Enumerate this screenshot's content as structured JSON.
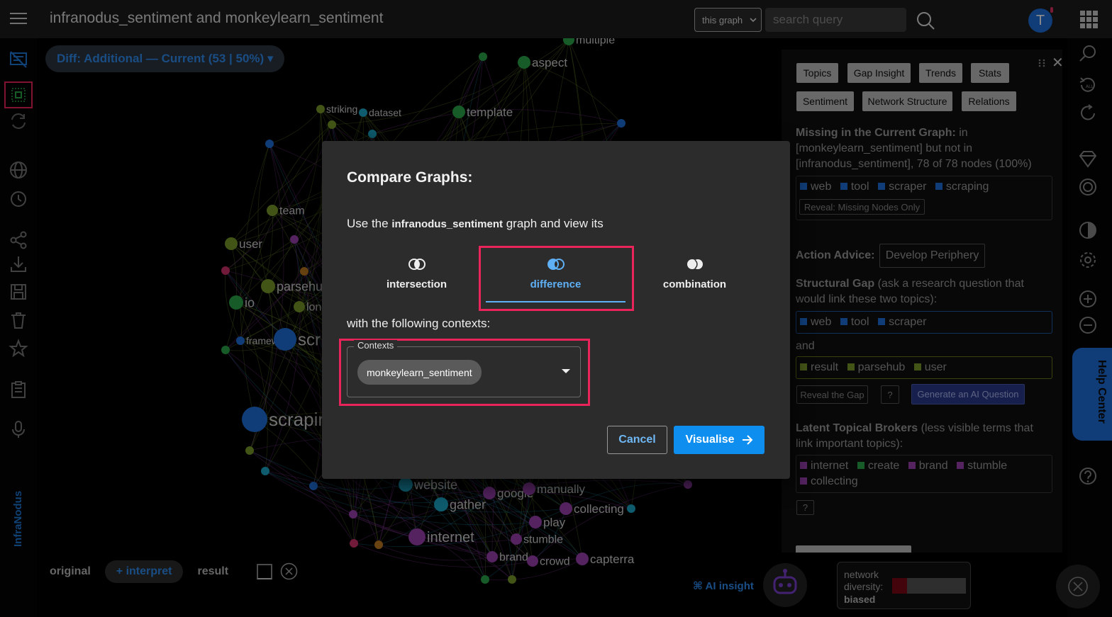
{
  "header": {
    "title": "infranodus_sentiment and monkeylearn_sentiment",
    "scope_select": "this graph",
    "search_placeholder": "search query",
    "avatar_letter": "T"
  },
  "sidebar": {
    "brand": "InfraNodus"
  },
  "canvas": {
    "diff_chip": "Diff: Additional — Current (53 | 50%) ▾",
    "nodes": [
      {
        "label": "multiple",
        "color": "#2aa84a",
        "size": 16
      },
      {
        "label": "aspect",
        "color": "#2aa84a",
        "size": 17
      },
      {
        "label": "striking",
        "color": "#7a9a2a",
        "size": 14
      },
      {
        "label": "dataset",
        "color": "#1aa8c8",
        "size": 14
      },
      {
        "label": "template",
        "color": "#2aa84a",
        "size": 17
      },
      {
        "label": "team",
        "color": "#7a9a2a",
        "size": 16
      },
      {
        "label": "user",
        "color": "#7a9a2a",
        "size": 17
      },
      {
        "label": "parsehu",
        "color": "#7a9a2a",
        "size": 18
      },
      {
        "label": "io",
        "color": "#2aa84a",
        "size": 18
      },
      {
        "label": "lon",
        "color": "#7a9a2a",
        "size": 16
      },
      {
        "label": "framework",
        "color": "#1e6fd9",
        "size": 14
      },
      {
        "label": "scr",
        "color": "#1e6fd9",
        "size": 24
      },
      {
        "label": "scrapir",
        "color": "#1e6fd9",
        "size": 26
      },
      {
        "label": "website",
        "color": "#1aa8c8",
        "size": 18
      },
      {
        "label": "google",
        "color": "#9a40b0",
        "size": 17
      },
      {
        "label": "manually",
        "color": "#9a40b0",
        "size": 17
      },
      {
        "label": "gather",
        "color": "#1aa8c8",
        "size": 18
      },
      {
        "label": "collecting",
        "color": "#9a40b0",
        "size": 17
      },
      {
        "label": "play",
        "color": "#9a40b0",
        "size": 17
      },
      {
        "label": "internet",
        "color": "#9a40b0",
        "size": 20
      },
      {
        "label": "stumble",
        "color": "#9a40b0",
        "size": 16
      },
      {
        "label": "brand",
        "color": "#9a40b0",
        "size": 16
      },
      {
        "label": "crowd",
        "color": "#9a40b0",
        "size": 16
      },
      {
        "label": "capterra",
        "color": "#9a40b0",
        "size": 17
      }
    ],
    "bottom": {
      "original": "original",
      "interpret": "+ interpret",
      "result": "result"
    },
    "ai_insight": "⌘ AI insight",
    "diversity_label": "network diversity:",
    "diversity_value": "biased",
    "diversity_fill": 0.2
  },
  "panel": {
    "tabs_row1": [
      "Topics",
      "Gap Insight",
      "Trends",
      "Stats"
    ],
    "tabs_row2": [
      "Sentiment",
      "Network Structure",
      "Relations"
    ],
    "missing_heading": "Missing in the Current Graph:",
    "missing_text": " in [monkeylearn_sentiment] but not in [infranodus_sentiment], 78 of 78 nodes (100%)",
    "missing_keywords": [
      "web",
      "tool",
      "scraper",
      "scraping"
    ],
    "reveal_missing": "Reveal: Missing Nodes Only",
    "action_label": "Action Advice:",
    "action_value": "Develop Periphery",
    "gap_heading": "Structural Gap",
    "gap_text": " (ask a research question that would link these two topics):",
    "gap_topic1": [
      "web",
      "tool",
      "scraper"
    ],
    "and_label": "and",
    "gap_topic2": [
      "result",
      "parsehub",
      "user"
    ],
    "reveal_gap": "Reveal the Gap",
    "question_mark": "?",
    "generate_ai": "Generate an AI Question",
    "brokers_heading": "Latent Topical Brokers",
    "brokers_text": " (less visible terms that link important topics):",
    "brokers": [
      {
        "label": "internet",
        "color": "#9a40b0"
      },
      {
        "label": "create",
        "color": "#2aa84a"
      },
      {
        "label": "brand",
        "color": "#9a40b0"
      },
      {
        "label": "stumble",
        "color": "#9a40b0"
      },
      {
        "label": "collecting",
        "color": "#9a40b0"
      }
    ],
    "brokers_help": "?",
    "colors": {
      "blue": "#1e6fd9",
      "olive": "#7a9a2a",
      "purple": "#9a40b0",
      "green": "#2aa84a"
    }
  },
  "rightrail": {
    "help_center": "Help Center"
  },
  "modal": {
    "title": "Compare Graphs:",
    "desc_before": "Use the ",
    "desc_graph": "infranodus_sentiment",
    "desc_after": " graph and view its",
    "options": [
      "intersection",
      "difference",
      "combination"
    ],
    "contexts_prompt": "with the following contexts:",
    "contexts_legend": "Contexts",
    "context_chip": "monkeylearn_sentiment",
    "cancel": "Cancel",
    "visualise": "Visualise"
  }
}
